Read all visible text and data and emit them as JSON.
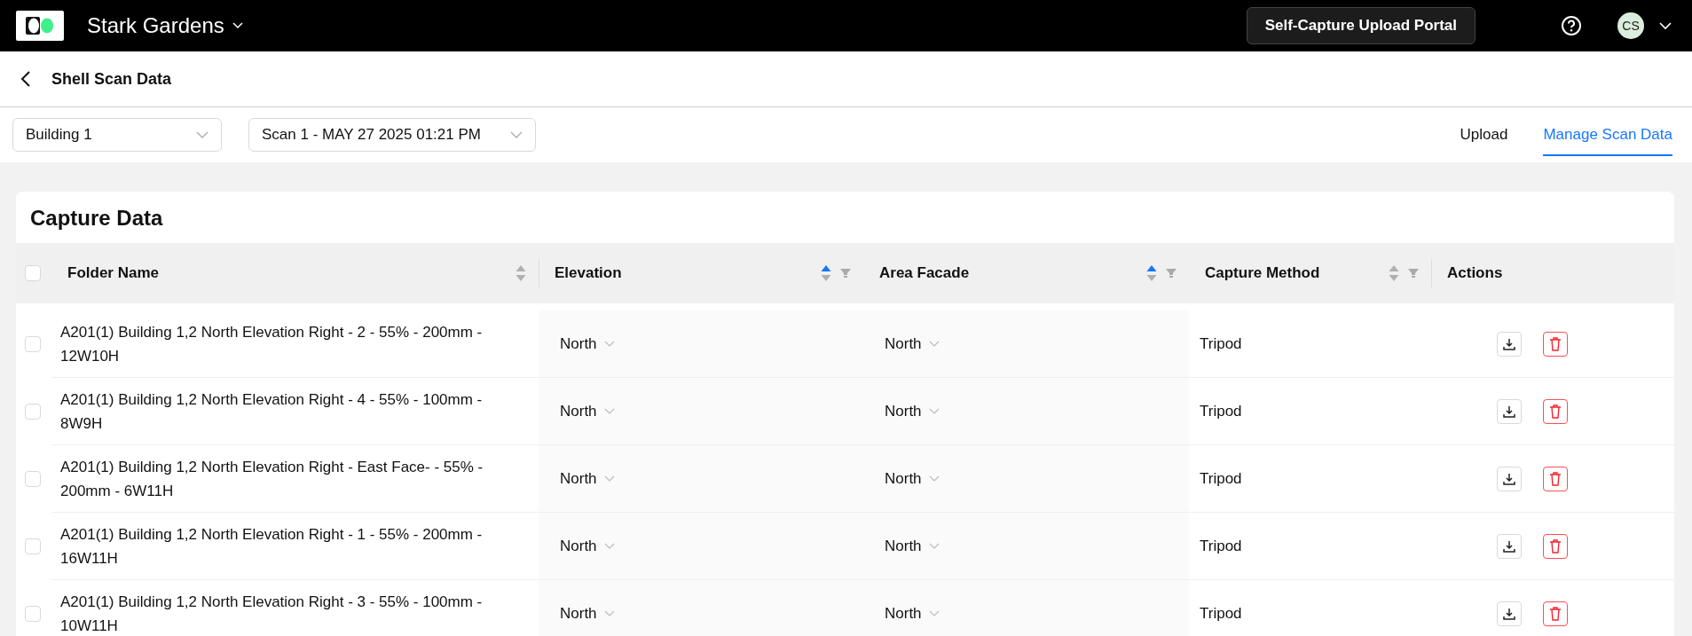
{
  "topbar": {
    "project": "Stark Gardens",
    "portal_button": "Self-Capture Upload Portal",
    "avatar": "CS"
  },
  "page": {
    "title": "Shell Scan Data"
  },
  "filters": [
    {
      "value": "Building 1"
    },
    {
      "value": "Scan 1 - MAY 27 2025 01:21 PM"
    }
  ],
  "tabs": [
    {
      "label": "Upload",
      "selected": false
    },
    {
      "label": "Manage Scan Data",
      "selected": true
    }
  ],
  "card": {
    "title": "Capture Data"
  },
  "table": {
    "select_all_checked": false,
    "columns": [
      {
        "label": "Folder Name",
        "sortable": true,
        "sorted_ascending": false,
        "filterable": false
      },
      {
        "label": "Elevation",
        "sortable": true,
        "sorted_ascending": true,
        "filterable": true
      },
      {
        "label": "Area Facade",
        "sortable": true,
        "sorted_ascending": true,
        "filterable": true
      },
      {
        "label": "Capture Method",
        "sortable": true,
        "sorted_ascending": false,
        "filterable": true
      },
      {
        "label": "Actions",
        "sortable": false,
        "filterable": false
      }
    ],
    "rows": [
      {
        "checked": false,
        "folder": "A201(1) Building 1,2 North Elevation Right - 2 - 55% - 200mm - 12W10H",
        "elevation": "North",
        "facade": "North",
        "method": "Tripod"
      },
      {
        "checked": false,
        "folder": "A201(1) Building 1,2 North Elevation Right - 4 - 55% - 100mm - 8W9H",
        "elevation": "North",
        "facade": "North",
        "method": "Tripod"
      },
      {
        "checked": false,
        "folder": "A201(1) Building 1,2 North Elevation Right - East Face- - 55% - 200mm - 6W11H",
        "elevation": "North",
        "facade": "North",
        "method": "Tripod"
      },
      {
        "checked": false,
        "folder": "A201(1) Building 1,2 North Elevation Right - 1 - 55% - 200mm - 16W11H",
        "elevation": "North",
        "facade": "North",
        "method": "Tripod"
      },
      {
        "checked": false,
        "folder": "A201(1) Building 1,2 North Elevation Right - 3 - 55% - 100mm - 10W11H",
        "elevation": "North",
        "facade": "North",
        "method": "Tripod"
      }
    ]
  }
}
